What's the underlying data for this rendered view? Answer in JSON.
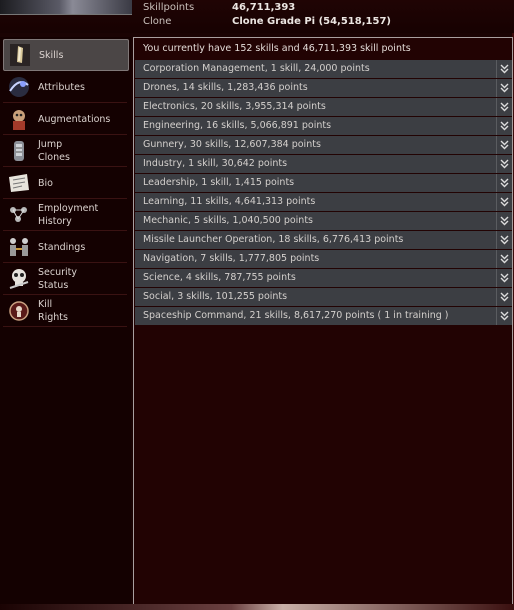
{
  "header": {
    "skillpoints_label": "Skillpoints",
    "skillpoints_value": "46,711,393",
    "clone_label": "Clone",
    "clone_value": "Clone Grade Pi (54,518,157)"
  },
  "sidebar": {
    "items": [
      {
        "label": "Skills",
        "icon": "skills-icon",
        "active": true
      },
      {
        "label": "Attributes",
        "icon": "attributes-icon"
      },
      {
        "label": "Augmentations",
        "icon": "augmentations-icon"
      },
      {
        "label": "Jump\nClones",
        "icon": "jump-clones-icon"
      },
      {
        "label": "Bio",
        "icon": "bio-icon"
      },
      {
        "label": "Employment\nHistory",
        "icon": "employment-history-icon"
      },
      {
        "label": "Standings",
        "icon": "standings-icon"
      },
      {
        "label": "Security\nStatus",
        "icon": "security-status-icon"
      },
      {
        "label": "Kill\nRights",
        "icon": "kill-rights-icon"
      }
    ]
  },
  "main": {
    "summary": "You currently have 152 skills and 46,711,393 skill points",
    "skill_groups": [
      "Corporation Management, 1 skill, 24,000 points",
      "Drones, 14 skills, 1,283,436 points",
      "Electronics, 20 skills, 3,955,314 points",
      "Engineering, 16 skills, 5,066,891 points",
      "Gunnery, 30 skills, 12,607,384 points",
      "Industry, 1 skill, 30,642 points",
      "Leadership, 1 skill, 1,415 points",
      "Learning, 11 skills, 4,641,313 points",
      "Mechanic, 5 skills, 1,040,500 points",
      "Missile Launcher Operation, 18 skills, 6,776,413 points",
      "Navigation, 7 skills, 1,777,805 points",
      "Science, 4 skills, 787,755 points",
      "Social, 3 skills, 101,255 points",
      "Spaceship Command, 21 skills, 8,617,270 points ( 1 in training )"
    ]
  },
  "colors": {
    "background": "#1a0303",
    "panel": "#220303",
    "row": "#3c3e43",
    "active_tab": "#4b4646"
  }
}
